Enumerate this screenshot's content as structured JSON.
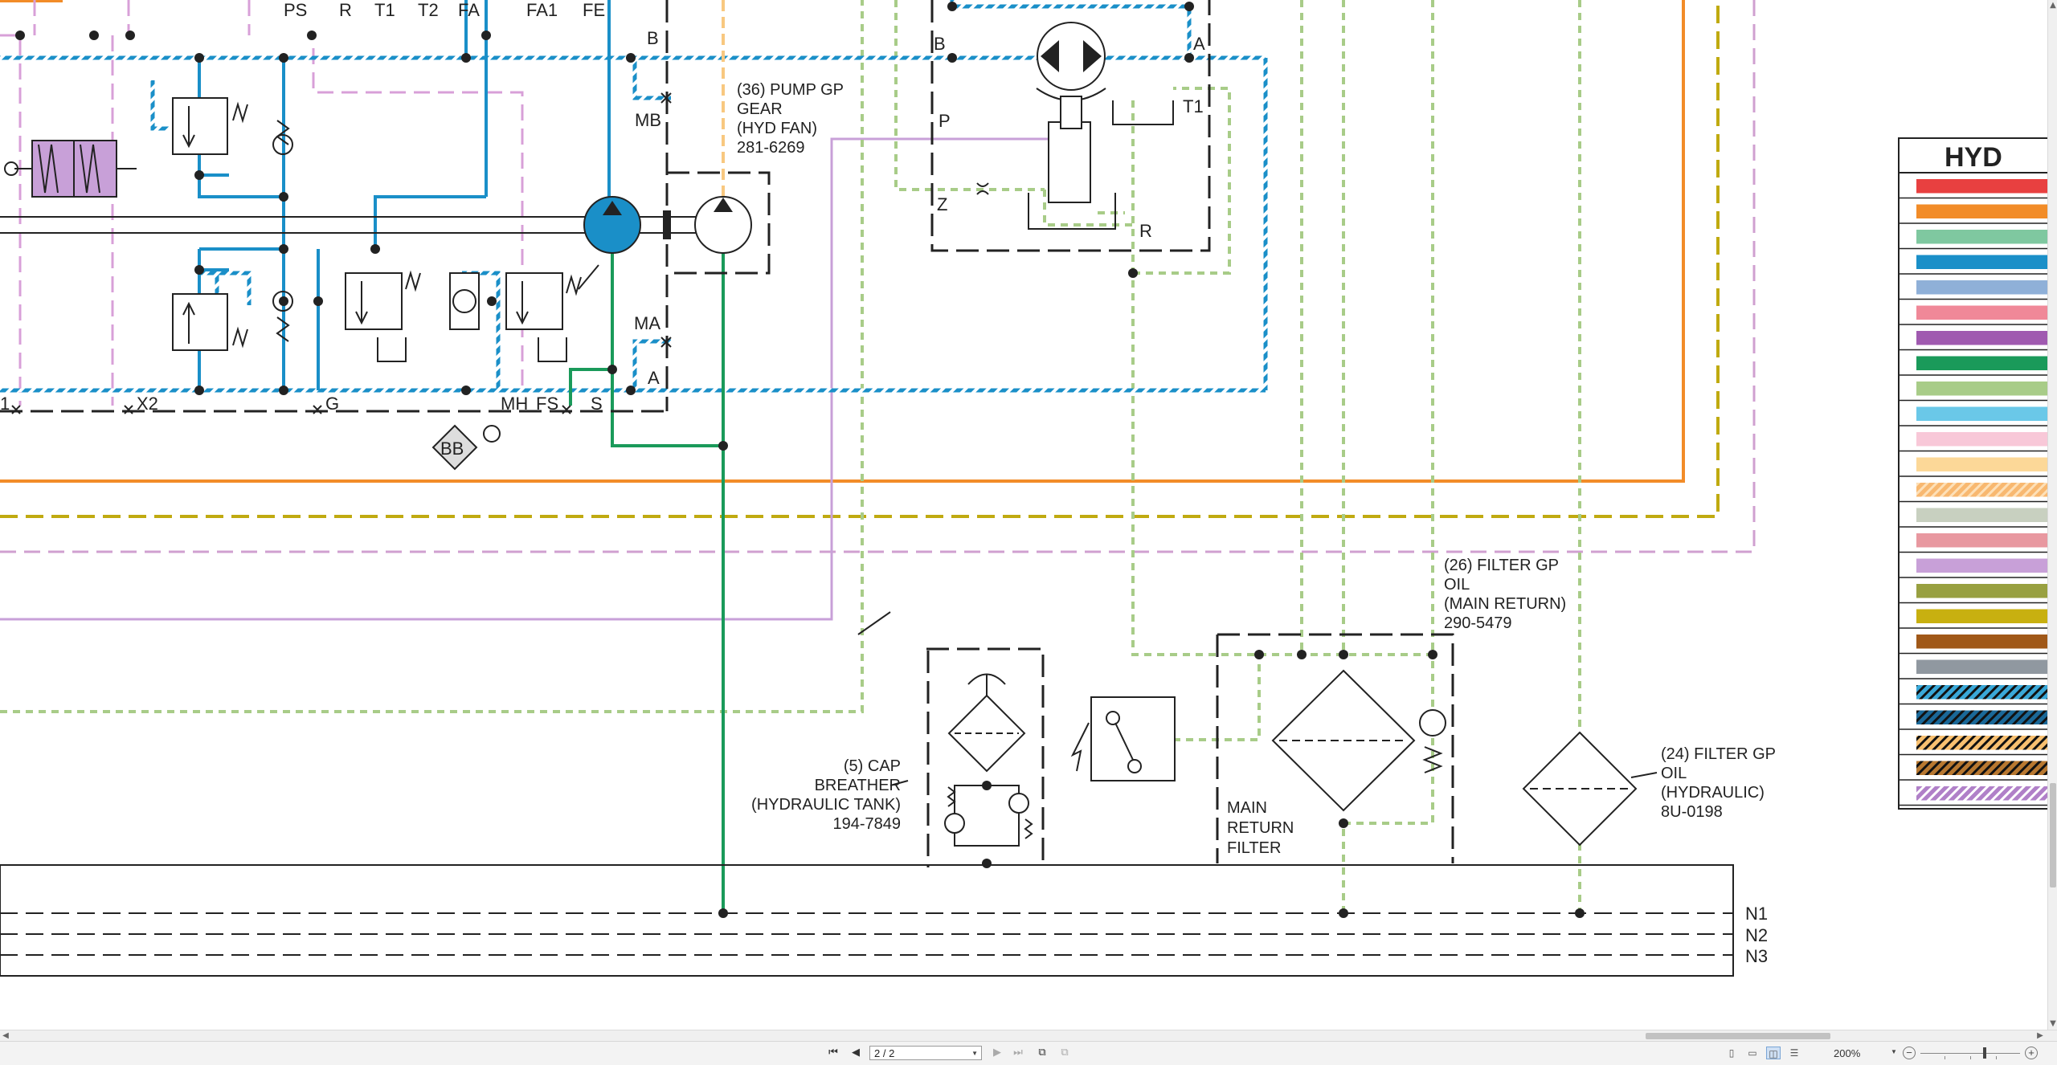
{
  "components": {
    "pump_fan": {
      "ref": "(36) PUMP GP",
      "line2": "GEAR",
      "line3": "(HYD FAN)",
      "part": "281-6269"
    },
    "cap_breather": {
      "ref": "(5) CAP",
      "line2": "BREATHER",
      "line3": "(HYDRAULIC TANK)",
      "part": "194-7849"
    },
    "filter_main": {
      "ref": "(26) FILTER GP",
      "line2": "OIL",
      "line3": "(MAIN RETURN)",
      "part": "290-5479"
    },
    "filter_hyd": {
      "ref": "(24) FILTER GP",
      "line2": "OIL",
      "line3": "(HYDRAULIC)",
      "part": "8U-0198"
    },
    "main_return_filter": {
      "line1": "MAIN",
      "line2": "RETURN",
      "line3": "FILTER"
    }
  },
  "ports": {
    "top": [
      "PS",
      "R",
      "T1",
      "T2",
      "FA",
      "FA1",
      "FE"
    ],
    "b": "B",
    "mb": "MB",
    "ma": "MA",
    "a": "A",
    "bottom": [
      "1",
      "X2",
      "G",
      "MH",
      "FS",
      "S"
    ],
    "bb": "BB",
    "motor_b": "B",
    "motor_a": "A",
    "motor_p": "P",
    "motor_t1": "T1",
    "motor_z": "Z",
    "motor_r": "R"
  },
  "tank_lines": [
    "N1",
    "N2",
    "N3"
  ],
  "legend": {
    "title": "HYD",
    "swatches": [
      {
        "color": "#e84040",
        "pattern": "solid"
      },
      {
        "color": "#f28c28",
        "pattern": "solid"
      },
      {
        "color": "#7fc8a0",
        "pattern": "solid"
      },
      {
        "color": "#1a8fc8",
        "pattern": "solid"
      },
      {
        "color": "#8fb0d8",
        "pattern": "solid"
      },
      {
        "color": "#f08898",
        "pattern": "solid"
      },
      {
        "color": "#a05ab0",
        "pattern": "solid"
      },
      {
        "color": "#1a9a5a",
        "pattern": "solid"
      },
      {
        "color": "#a8cc88",
        "pattern": "solid"
      },
      {
        "color": "#6ac8e8",
        "pattern": "solid"
      },
      {
        "color": "#f8c8d8",
        "pattern": "solid"
      },
      {
        "color": "#fcd898",
        "pattern": "solid"
      },
      {
        "color": "#f8b870",
        "pattern": "striped-light"
      },
      {
        "color": "#c8d0c0",
        "pattern": "solid"
      },
      {
        "color": "#e898a0",
        "pattern": "solid"
      },
      {
        "color": "#c8a0d8",
        "pattern": "solid"
      },
      {
        "color": "#98a040",
        "pattern": "solid"
      },
      {
        "color": "#c8b010",
        "pattern": "solid"
      },
      {
        "color": "#a05818",
        "pattern": "solid"
      },
      {
        "color": "#9098a0",
        "pattern": "solid"
      },
      {
        "color": "#3aa8d8",
        "pattern": "striped-black"
      },
      {
        "color": "#1a6898",
        "pattern": "striped-black"
      },
      {
        "color": "#f8c070",
        "pattern": "striped-black"
      },
      {
        "color": "#b87830",
        "pattern": "striped-black"
      },
      {
        "color": "#b080c8",
        "pattern": "striped-white"
      }
    ]
  },
  "line_colors": {
    "blue": "#1a8fc8",
    "green": "#1a9a5a",
    "orange": "#f28c28",
    "olive": "#c0aa10",
    "lilac": "#c8a0d8",
    "lightgreen": "#a8cc88",
    "peach": "#f8c880"
  },
  "viewer": {
    "page_field": "2 / 2",
    "zoom": "200%",
    "icons": [
      "first-page-icon",
      "prev-page-icon",
      "next-page-icon",
      "last-page-icon"
    ]
  }
}
